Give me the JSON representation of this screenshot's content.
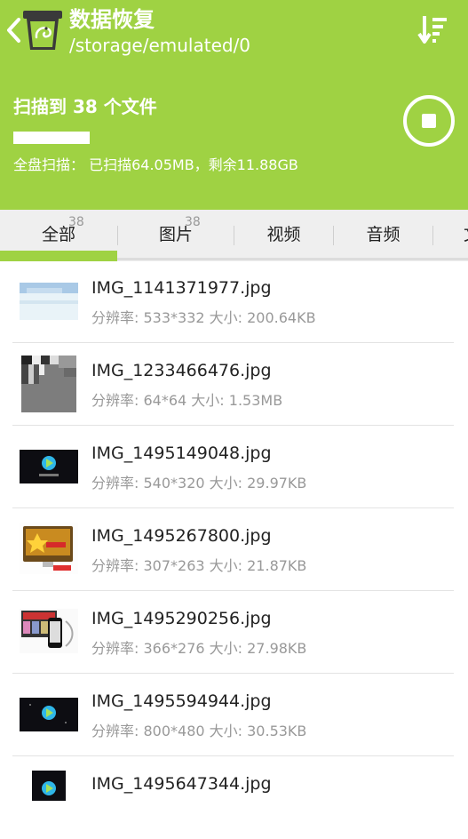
{
  "header": {
    "title": "数据恢复",
    "path": "/storage/emulated/0",
    "back_icon": "chevron-left-icon",
    "app_icon": "recycle-bin-chameleon-icon",
    "sort_icon": "sort-icon",
    "background_color": "#9fd243"
  },
  "scan": {
    "title": "扫描到 38 个文件",
    "status": "全盘扫描： 已扫描64.05MB，剩余11.88GB",
    "progress_fraction": 0.16,
    "stop_icon": "stop-circle-icon"
  },
  "tabs": [
    {
      "label": "全部",
      "badge": "38",
      "selected": true
    },
    {
      "label": "图片",
      "badge": "38",
      "selected": false
    },
    {
      "label": "视频",
      "badge": "",
      "selected": false
    },
    {
      "label": "音频",
      "badge": "",
      "selected": false
    },
    {
      "label": "文",
      "badge": "",
      "selected": false
    }
  ],
  "files": [
    {
      "name": "IMG_1141371977.jpg",
      "meta": "分辨率: 533*332 大小: 200.64KB",
      "thumb": "sky-photo"
    },
    {
      "name": "IMG_1233466476.jpg",
      "meta": "分辨率: 64*64 大小: 1.53MB",
      "thumb": "gray-glitch"
    },
    {
      "name": "IMG_1495149048.jpg",
      "meta": "分辨率: 540*320 大小: 29.97KB",
      "thumb": "video-logo-dark"
    },
    {
      "name": "IMG_1495267800.jpg",
      "meta": "分辨率: 307*263 大小: 21.87KB",
      "thumb": "monitor-promo"
    },
    {
      "name": "IMG_1495290256.jpg",
      "meta": "分辨率: 366*276 大小: 27.98KB",
      "thumb": "devices-screenshot"
    },
    {
      "name": "IMG_1495594944.jpg",
      "meta": "分辨率: 800*480 大小: 30.53KB",
      "thumb": "video-logo-dark"
    },
    {
      "name": "IMG_1495647344.jpg",
      "meta": "",
      "thumb": "video-logo-dark"
    }
  ]
}
